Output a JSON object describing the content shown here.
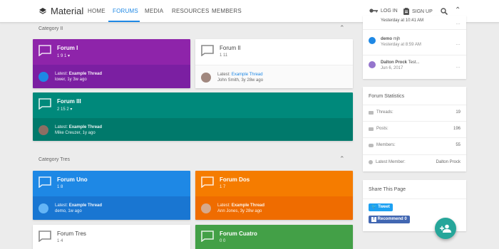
{
  "header": {
    "title": "Material",
    "nav": [
      "HOME",
      "FORUMS",
      "MEDIA",
      "RESOURCES",
      "MEMBERS"
    ],
    "login": "LOG IN",
    "signup": "SIGN UP"
  },
  "categories": [
    {
      "title": "Category II"
    },
    {
      "title": "Category Tres"
    }
  ],
  "forums": [
    {
      "title": "Forum I",
      "stats": "1  9  1 ▾",
      "latest_label": "Latest:",
      "latest_thread": "Example Thread",
      "meta": "lower, 1y 3w ago",
      "color": "#8e24aa"
    },
    {
      "title": "Forum II",
      "stats": "1  11",
      "latest_label": "Latest:",
      "latest_thread": "Example Thread",
      "meta": "John Smith, 3y 28w ago",
      "color": "#ffffff"
    },
    {
      "title": "Forum III",
      "stats": "2  15  2 ▾",
      "latest_label": "Latest:",
      "latest_thread": "Example Thread",
      "meta": "Mike Creuzer, 1y ago",
      "color": "#00897b"
    },
    {
      "title": "Forum Uno",
      "stats": "1  8",
      "latest_label": "Latest:",
      "latest_thread": "Example Thread",
      "meta": "demo, 1w ago",
      "color": "#1e88e5"
    },
    {
      "title": "Forum Dos",
      "stats": "1  7",
      "latest_label": "Latest:",
      "latest_thread": "Example Thread",
      "meta": "Ann Jones, 3y 28w ago",
      "color": "#f57c00"
    },
    {
      "title": "Forum Tres",
      "stats": "1  4",
      "color": "#ffffff"
    },
    {
      "title": "Forum Cuatro",
      "stats": "0  0",
      "color": "#43a047"
    }
  ],
  "sidebar": {
    "recent": [
      {
        "meta": "Yesterday at 10:41 AM"
      },
      {
        "name": "demo",
        "text": "mjh",
        "meta": "Yesterday at 8:59 AM"
      },
      {
        "name": "Dalton Prock",
        "text": "Test...",
        "meta": "Jun 6, 2017"
      }
    ],
    "stats": {
      "title": "Forum Statistics",
      "rows": [
        {
          "label": "Threads:",
          "value": "19"
        },
        {
          "label": "Posts:",
          "value": "196"
        },
        {
          "label": "Members:",
          "value": "55"
        },
        {
          "label": "Latest Member:",
          "value": "Dalton Prock"
        }
      ]
    },
    "share": {
      "title": "Share This Page",
      "tweet": "Tweet",
      "recommend": "Recommend 0"
    }
  }
}
